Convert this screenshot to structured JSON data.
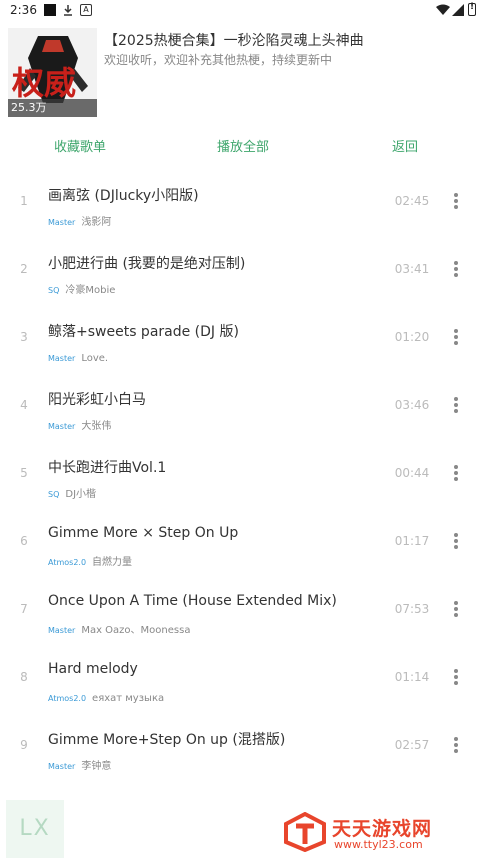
{
  "status_bar": {
    "time": "2:36",
    "icons": [
      "notification-square-icon",
      "download-icon",
      "a-badge-icon",
      "wifi-icon",
      "signal-icon",
      "battery-alert-icon"
    ],
    "a_badge": "A"
  },
  "playlist": {
    "cover_text": "权威",
    "play_count": "25.3万",
    "title": "【2025热梗合集】一秒沦陷灵魂上头神曲",
    "description": "欢迎收听，欢迎补充其他热梗，持续更新中"
  },
  "actions": {
    "collect": "收藏歌单",
    "play_all": "播放全部",
    "back": "返回"
  },
  "songs": [
    {
      "index": "1",
      "title": "画离弦 (DJlucky小阳版)",
      "quality": "Master",
      "artist": "浅影阿",
      "duration": "02:45"
    },
    {
      "index": "2",
      "title": "小肥进行曲 (我要的是绝对压制)",
      "quality": "SQ",
      "artist": "冷豪Mobie",
      "duration": "03:41"
    },
    {
      "index": "3",
      "title": "鲸落+sweets parade (DJ 版)",
      "quality": "Master",
      "artist": "Love.",
      "duration": "01:20"
    },
    {
      "index": "4",
      "title": "阳光彩虹小白马",
      "quality": "Master",
      "artist": "大张伟",
      "duration": "03:46"
    },
    {
      "index": "5",
      "title": "中长跑进行曲Vol.1",
      "quality": "SQ",
      "artist": "DJ小楷",
      "duration": "00:44"
    },
    {
      "index": "6",
      "title": "Gimme More × Step On Up",
      "quality": "Atmos2.0",
      "artist": "自燃力量",
      "duration": "01:17"
    },
    {
      "index": "7",
      "title": "Once Upon A Time (House Extended Mix)",
      "quality": "Master",
      "artist": "Max Oazo、Moonessa",
      "duration": "07:53"
    },
    {
      "index": "8",
      "title": "Hard melody",
      "quality": "Atmos2.0",
      "artist": "еяхат музыка",
      "duration": "01:14"
    },
    {
      "index": "9",
      "title": "Gimme More+Step On up (混搭版)",
      "quality": "Master",
      "artist": "李钟意",
      "duration": "02:57"
    }
  ],
  "player": {
    "thumb_text": "LX"
  },
  "watermark": {
    "name": "天天游戏网",
    "url": "www.ttyl23.com"
  },
  "colors": {
    "accent": "#3ea66c",
    "quality_tag": "#3b9ad6",
    "watermark": "#e8452c"
  }
}
